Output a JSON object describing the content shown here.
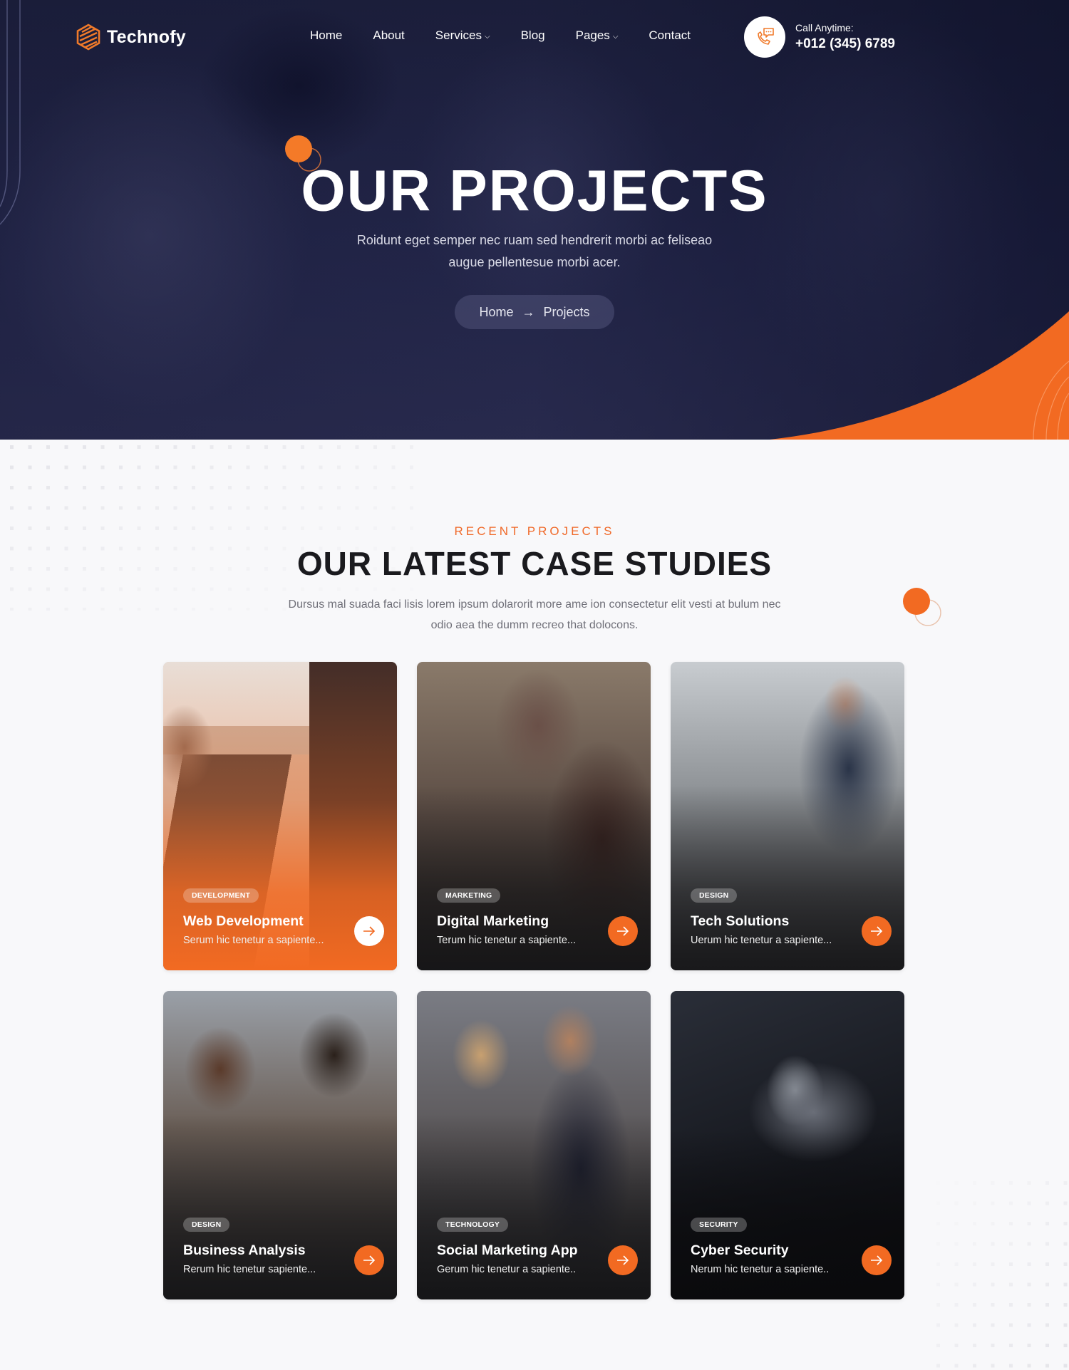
{
  "colors": {
    "accent": "#f26a22",
    "hero_bg": "#1f2243",
    "heading": "#1a1a1e",
    "body_text": "#6f6f78",
    "page_bg": "#f8f8fa"
  },
  "nav": {
    "logo_icon": "hexagon-stripes-icon",
    "logo_text": "Technofy",
    "items": [
      {
        "label": "Home",
        "has_dropdown": false
      },
      {
        "label": "About",
        "has_dropdown": false
      },
      {
        "label": "Services",
        "has_dropdown": true
      },
      {
        "label": "Blog",
        "has_dropdown": false
      },
      {
        "label": "Pages",
        "has_dropdown": true
      },
      {
        "label": "Contact",
        "has_dropdown": false
      }
    ],
    "dropdown_glyph": "⌄",
    "call": {
      "icon": "phone-chat-icon",
      "label": "Call Anytime:",
      "phone": "+012 (345) 6789"
    }
  },
  "hero": {
    "title": "OUR PROJECTS",
    "subtitle_line1": "Roidunt eget semper nec ruam sed hendrerit morbi ac feliseao",
    "subtitle_line2": "augue pellentesue morbi acer.",
    "breadcrumb": {
      "home": "Home",
      "separator": "→",
      "current": "Projects"
    }
  },
  "section": {
    "eyebrow": "RECENT PROJECTS",
    "title": "OUR LATEST CASE STUDIES",
    "desc_line1": "Dursus mal suada faci lisis lorem ipsum dolarorit more ame ion consectetur elit vesti at bulum nec",
    "desc_line2": "odio aea the dumm recreo that dolocons."
  },
  "projects": [
    {
      "tag": "DEVELOPMENT",
      "title": "Web Development",
      "desc": "Serum hic tenetur a sapiente...",
      "active": true
    },
    {
      "tag": "MARKETING",
      "title": "Digital Marketing",
      "desc": "Terum hic tenetur a sapiente...",
      "active": false
    },
    {
      "tag": "DESIGN",
      "title": "Tech Solutions",
      "desc": "Uerum hic tenetur a sapiente...",
      "active": false
    },
    {
      "tag": "DESIGN",
      "title": "Business Analysis",
      "desc": "Rerum hic tenetur sapiente...",
      "active": false
    },
    {
      "tag": "TECHNOLOGY",
      "title": "Social Marketing App",
      "desc": "Gerum hic tenetur a sapiente..",
      "active": false
    },
    {
      "tag": "SECURITY",
      "title": "Cyber Security",
      "desc": "Nerum hic tenetur a sapiente..",
      "active": false
    }
  ]
}
